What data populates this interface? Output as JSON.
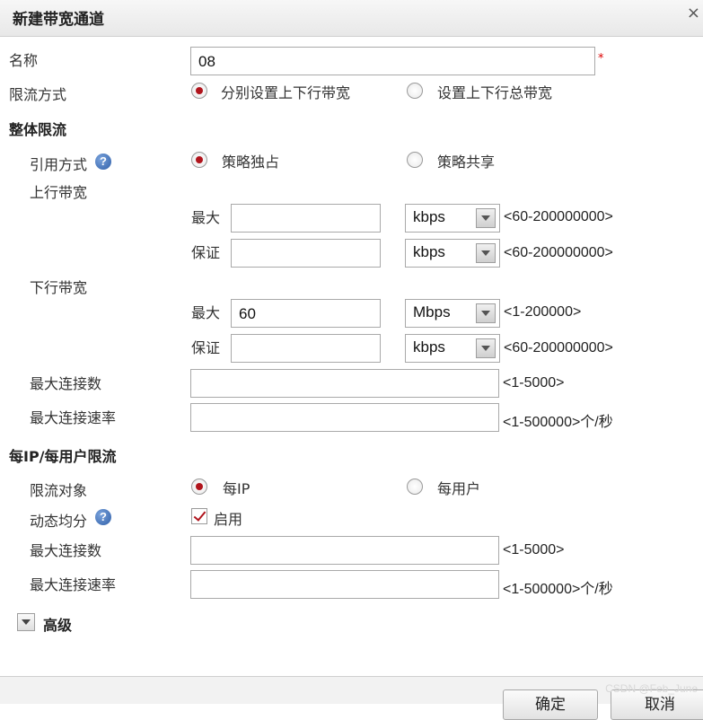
{
  "dialog": {
    "title": "新建带宽通道",
    "close_symbol": "×"
  },
  "form": {
    "name_label": "名称",
    "name_value": "08",
    "required_mark": "*",
    "limit_mode_label": "限流方式",
    "limit_mode_options": [
      {
        "label": "分别设置上下行带宽",
        "selected": true
      },
      {
        "label": "设置上下行总带宽",
        "selected": false
      }
    ]
  },
  "overall": {
    "section_title": "整体限流",
    "reference_label": "引用方式",
    "help_symbol": "?",
    "reference_options": [
      {
        "label": "策略独占",
        "selected": true
      },
      {
        "label": "策略共享",
        "selected": false
      }
    ],
    "uplink_label": "上行带宽",
    "uplink": {
      "max_label": "最大",
      "max_value": "",
      "max_unit": "kbps",
      "max_range": "<60-200000000>",
      "guarantee_label": "保证",
      "guarantee_value": "",
      "guarantee_unit": "kbps",
      "guarantee_range": "<60-200000000>"
    },
    "downlink_label": "下行带宽",
    "downlink": {
      "max_label": "最大",
      "max_value": "60",
      "max_unit": "Mbps",
      "max_range": "<1-200000>",
      "guarantee_label": "保证",
      "guarantee_value": "",
      "guarantee_unit": "kbps",
      "guarantee_range": "<60-200000000>"
    },
    "max_conn_label": "最大连接数",
    "max_conn_value": "",
    "max_conn_range": "<1-5000>",
    "max_conn_rate_label": "最大连接速率",
    "max_conn_rate_value": "",
    "max_conn_rate_range": "<1-500000>个/秒"
  },
  "per_ip": {
    "section_title": "每IP/每用户限流",
    "target_label": "限流对象",
    "target_options": [
      {
        "label": "每IP",
        "selected": true
      },
      {
        "label": "每用户",
        "selected": false
      }
    ],
    "dynamic_label": "动态均分",
    "help_symbol": "?",
    "enable_label": "启用",
    "enable_checked": true,
    "max_conn_label": "最大连接数",
    "max_conn_value": "",
    "max_conn_range": "<1-5000>",
    "max_conn_rate_label": "最大连接速率",
    "max_conn_rate_value": "",
    "max_conn_rate_range": "<1-500000>个/秒"
  },
  "advanced": {
    "label": "高级"
  },
  "footer": {
    "ok_label": "确定",
    "cancel_label": "取消"
  },
  "watermark": "CSDN @Feb_June"
}
